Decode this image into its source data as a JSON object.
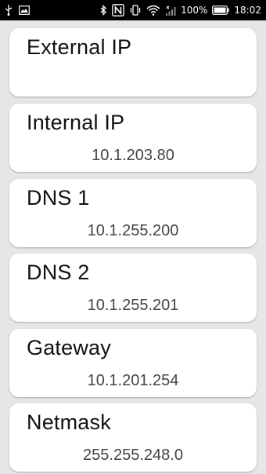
{
  "status_bar": {
    "battery_percent": "100%",
    "time": "18:02",
    "icons": [
      "usb-icon",
      "gallery-icon",
      "bluetooth-icon",
      "nfc-icon",
      "vibrate-icon",
      "wifi-icon",
      "signal-icon",
      "battery-icon"
    ]
  },
  "cards": [
    {
      "title": "External IP",
      "value": ""
    },
    {
      "title": "Internal IP",
      "value": "10.1.203.80"
    },
    {
      "title": "DNS 1",
      "value": "10.1.255.200"
    },
    {
      "title": "DNS 2",
      "value": "10.1.255.201"
    },
    {
      "title": "Gateway",
      "value": "10.1.201.254"
    },
    {
      "title": "Netmask",
      "value": "255.255.248.0"
    }
  ]
}
